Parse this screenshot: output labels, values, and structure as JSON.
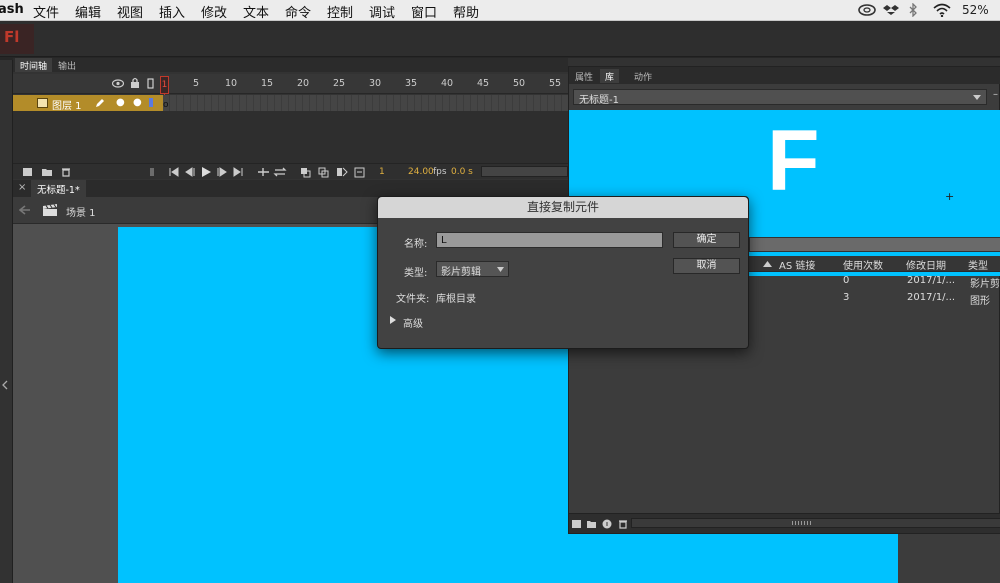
{
  "menubar": {
    "app": "ash",
    "items": [
      "文件",
      "编辑",
      "视图",
      "插入",
      "修改",
      "文本",
      "命令",
      "控制",
      "调试",
      "窗口",
      "帮助"
    ],
    "battery": "52%"
  },
  "app": {
    "logo": "Fl"
  },
  "timeline": {
    "tabs": [
      "时间轴",
      "输出"
    ],
    "ruler": [
      "1",
      "5",
      "10",
      "15",
      "20",
      "25",
      "30",
      "35",
      "40",
      "45",
      "50",
      "55"
    ],
    "layer_name": "图层 1",
    "playhead": "1",
    "current_frame": "1",
    "fps": "24.00",
    "fps_unit": "fps",
    "time": "0.0 s"
  },
  "document": {
    "tab": "无标题-1*",
    "scene": "场景 1"
  },
  "library": {
    "tabs": [
      "属性",
      "库",
      "动作"
    ],
    "selected_doc": "无标题-1",
    "preview_letter": "F",
    "columns": [
      "AS 链接",
      "使用次数",
      "修改日期",
      "类型"
    ],
    "rows": [
      {
        "count": "0",
        "date": "2017/1/...",
        "type": "影片剪"
      },
      {
        "count": "3",
        "date": "2017/1/...",
        "type": "图形"
      }
    ]
  },
  "dialog": {
    "title": "直接复制元件",
    "name_label": "名称:",
    "name_value": "L",
    "type_label": "类型:",
    "type_value": "影片剪辑",
    "folder_label": "文件夹:",
    "folder_value": "库根目录",
    "advanced": "高级",
    "ok": "确定",
    "cancel": "取消"
  },
  "colors": {
    "stage": "#00c2ff",
    "layer_highlight": "#b38c29",
    "accent_orange": "#e0b040",
    "playhead": "#c0392b"
  }
}
